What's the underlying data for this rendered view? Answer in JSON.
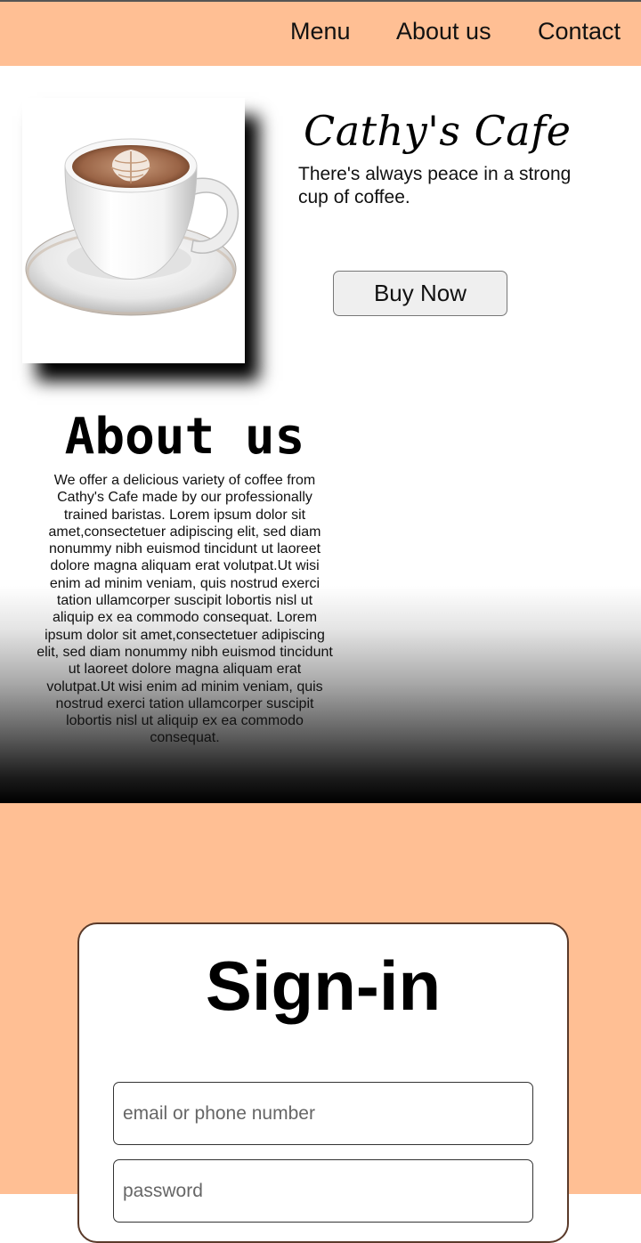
{
  "nav": {
    "items": [
      {
        "label": "Menu"
      },
      {
        "label": "About us"
      },
      {
        "label": "Contact"
      }
    ]
  },
  "hero": {
    "title": "Cathy's Cafe",
    "tagline": "There's always peace in a strong cup of coffee.",
    "buy_label": "Buy Now",
    "image_icon": "coffee-cup-latte-art"
  },
  "about": {
    "title": "About us",
    "text": "We offer a delicious variety of coffee from Cathy's Cafe made by our professionally trained baristas. Lorem ipsum dolor sit amet,consectetuer adipiscing elit, sed diam nonummy nibh euismod tincidunt ut laoreet dolore magna aliquam erat volutpat.Ut wisi enim ad minim veniam, quis nostrud exerci tation ullamcorper suscipit lobortis nisl ut aliquip ex ea commodo consequat. Lorem ipsum dolor sit amet,consectetuer adipiscing elit, sed diam nonummy nibh euismod tincidunt ut laoreet dolore magna aliquam erat volutpat.Ut wisi enim ad minim veniam, quis nostrud exerci tation ullamcorper suscipit lobortis nisl ut aliquip ex ea commodo consequat."
  },
  "signin": {
    "title": "Sign-in",
    "email_placeholder": "email or phone number",
    "password_placeholder": "password"
  },
  "colors": {
    "accent": "#ffbf94"
  }
}
